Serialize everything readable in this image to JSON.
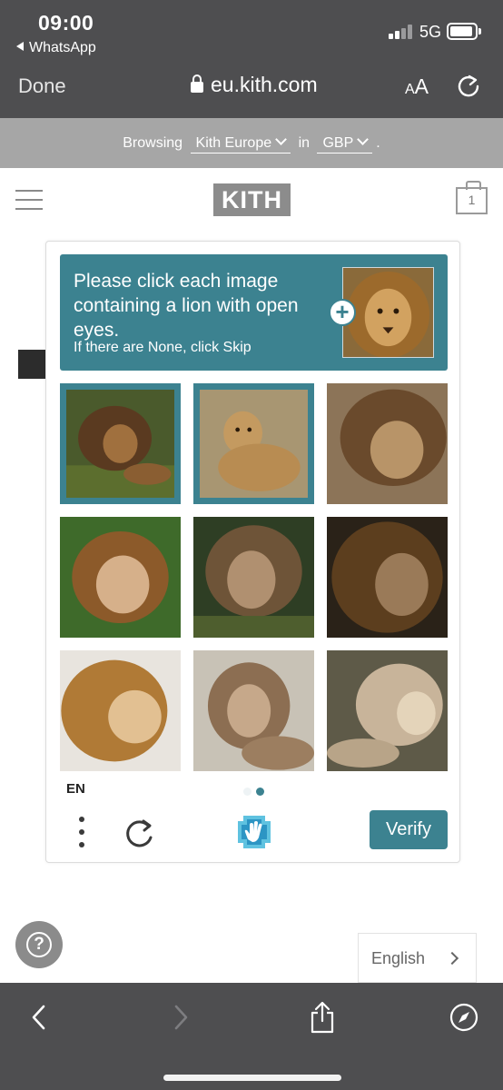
{
  "status_bar": {
    "time": "09:00",
    "back_app": "WhatsApp",
    "network": "5G"
  },
  "browser": {
    "done_label": "Done",
    "url": "eu.kith.com",
    "aa_small": "A",
    "aa_big": "A"
  },
  "country_bar": {
    "browsing_label": "Browsing",
    "region": "Kith Europe",
    "in_label": "in",
    "currency": "GBP",
    "end": "."
  },
  "site": {
    "logo": "KITH",
    "cart_count": "1"
  },
  "captcha": {
    "prompt": "Please click each image containing a lion with open eyes.",
    "sub_prompt": "If there are None, click Skip",
    "language": "EN",
    "verify_label": "Verify",
    "accent_color": "#3c8290",
    "page_dots": 2,
    "active_page": 2,
    "tiles": [
      {
        "selected": true
      },
      {
        "selected": true
      },
      {
        "selected": false
      },
      {
        "selected": false
      },
      {
        "selected": false
      },
      {
        "selected": false
      },
      {
        "selected": false
      },
      {
        "selected": false
      },
      {
        "selected": false
      }
    ]
  },
  "footer": {
    "help_icon": "question-mark-icon",
    "language_selector": "English"
  },
  "toolbar": {
    "icons": [
      "back-arrow-icon",
      "forward-arrow-icon",
      "share-icon",
      "compass-icon"
    ]
  }
}
